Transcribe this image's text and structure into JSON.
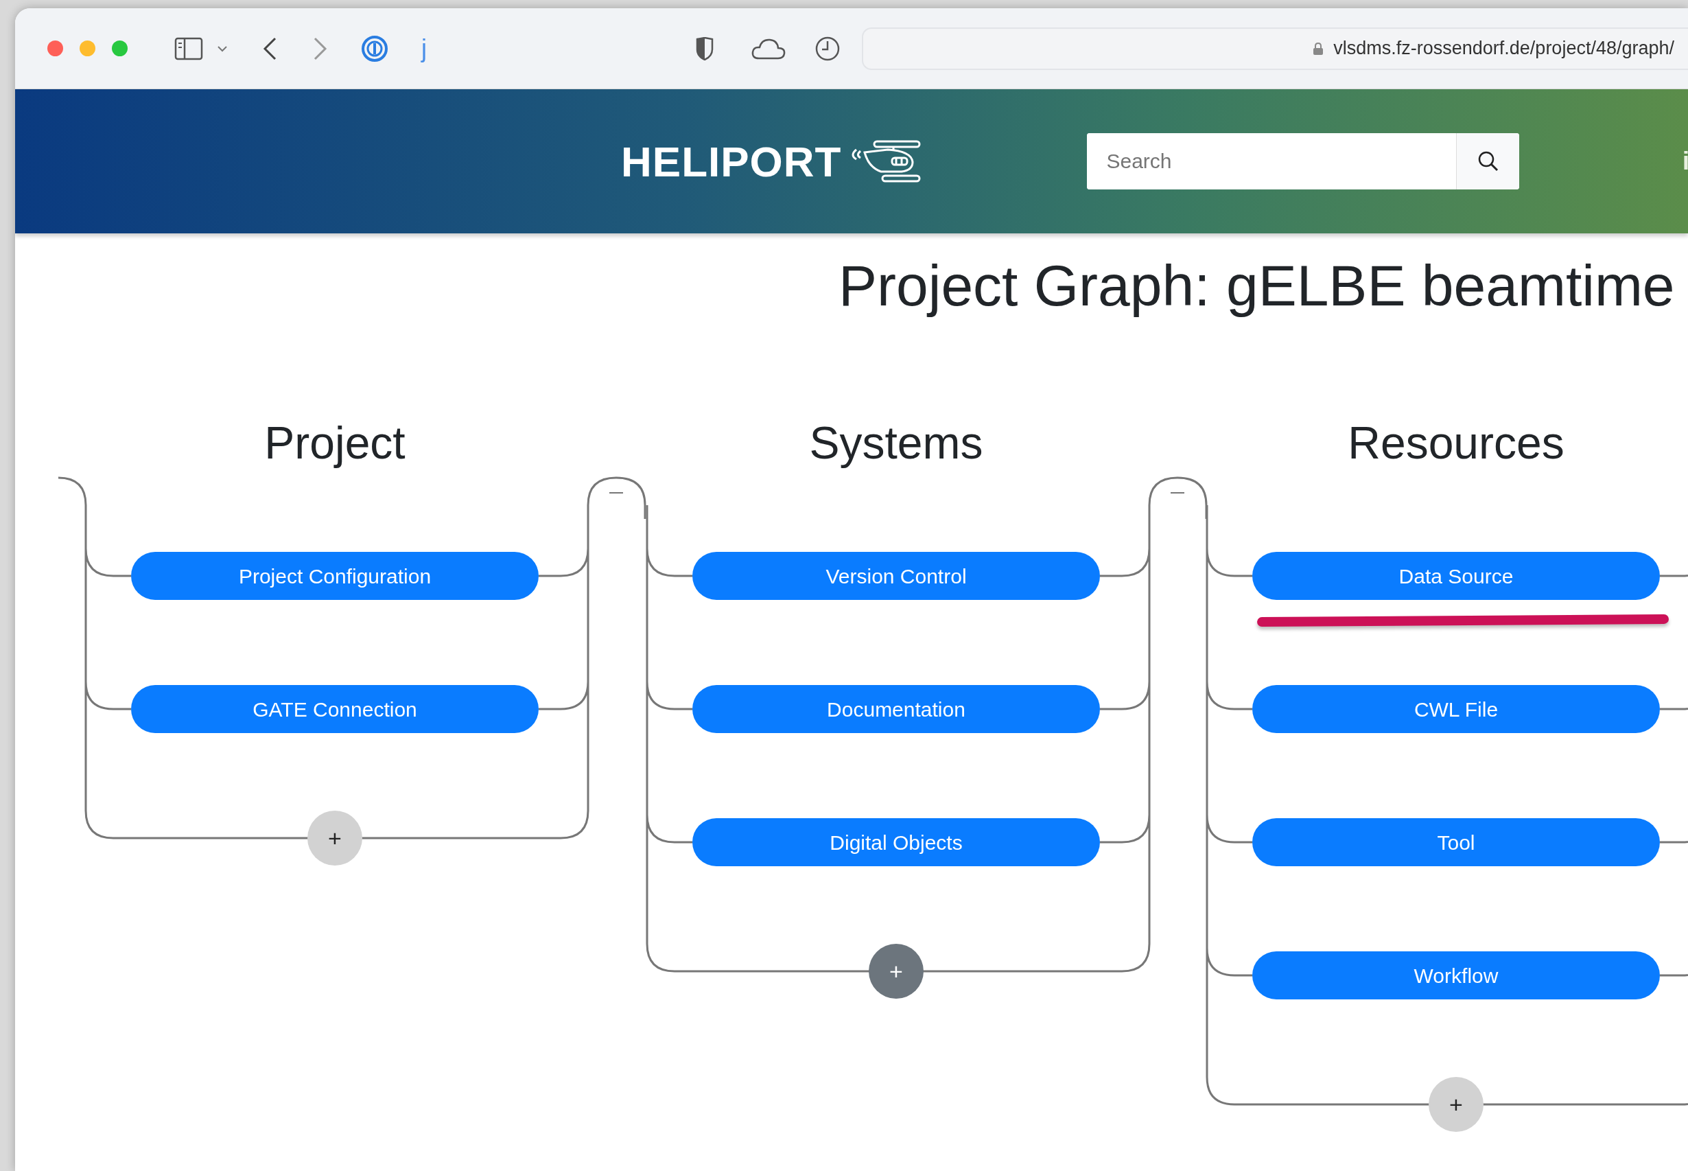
{
  "browser": {
    "extension_label": "j",
    "url": "vlsdms.fz-rossendorf.de/project/48/graph/"
  },
  "header": {
    "brand": "HELIPORT",
    "search": {
      "placeholder": "Search"
    },
    "info_label": "i"
  },
  "title": "Project Graph: gELBE beamtime",
  "columns": [
    {
      "heading": "Project",
      "items": [
        {
          "label": "Project Configuration",
          "marked": false
        },
        {
          "label": "GATE Connection",
          "marked": false
        }
      ],
      "add_button": {
        "label": "+",
        "active": false
      }
    },
    {
      "heading": "Systems",
      "items": [
        {
          "label": "Version Control",
          "marked": false
        },
        {
          "label": "Documentation",
          "marked": false
        },
        {
          "label": "Digital Objects",
          "marked": false
        }
      ],
      "add_button": {
        "label": "+",
        "active": true
      }
    },
    {
      "heading": "Resources",
      "items": [
        {
          "label": "Data Source",
          "marked": true
        },
        {
          "label": "CWL File",
          "marked": false
        },
        {
          "label": "Tool",
          "marked": false
        },
        {
          "label": "Workflow",
          "marked": false
        }
      ],
      "add_button": {
        "label": "+",
        "active": false
      }
    }
  ]
}
